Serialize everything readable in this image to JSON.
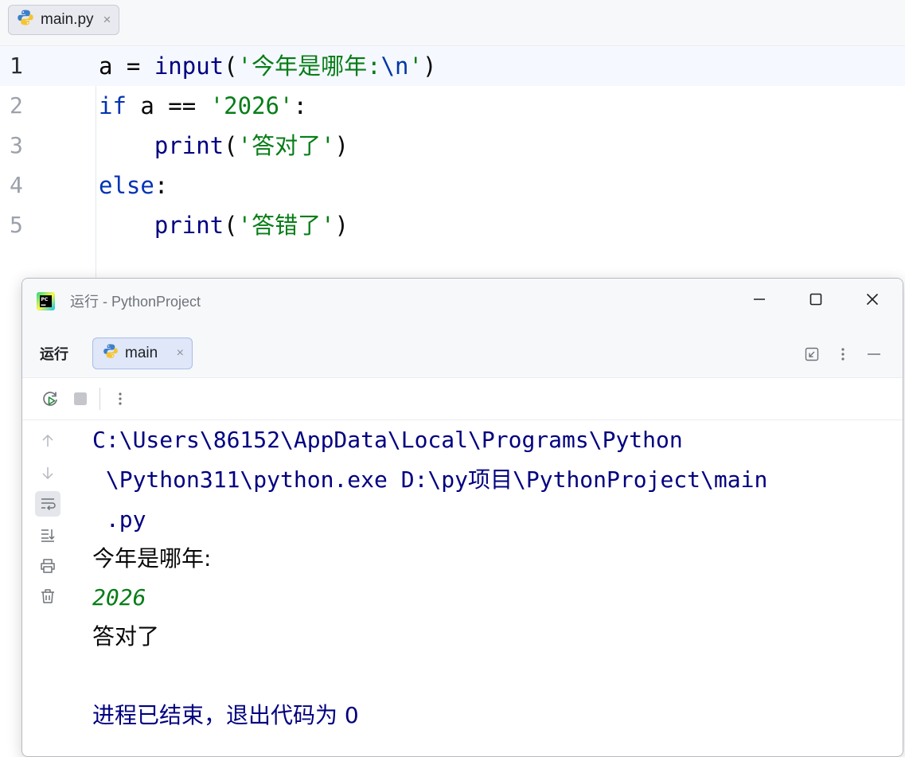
{
  "editor": {
    "tab": {
      "filename": "main.py",
      "close": "×"
    },
    "lines": [
      {
        "number": "1",
        "tokens": {
          "a": "a = ",
          "b": "input",
          "c": "(",
          "d": "'今年是哪年:",
          "e": "\\n",
          "f": "'",
          "g": ")"
        }
      },
      {
        "number": "2",
        "tokens": {
          "a": "if",
          "b": " a == ",
          "c": "'2026'",
          "d": ":"
        }
      },
      {
        "number": "3",
        "tokens": {
          "a": "    ",
          "b": "print",
          "c": "(",
          "d": "'答对了'",
          "e": ")"
        }
      },
      {
        "number": "4",
        "tokens": {
          "a": "else",
          "b": ":"
        }
      },
      {
        "number": "5",
        "tokens": {
          "a": "    ",
          "b": "print",
          "c": "(",
          "d": "'答错了'",
          "e": ")"
        }
      }
    ]
  },
  "run_window": {
    "title": "运行 - PythonProject",
    "tool_label": "运行",
    "run_tab": {
      "label": "main",
      "close": "×"
    },
    "console": {
      "cmd_line_1": "C:\\Users\\86152\\AppData\\Local\\Programs\\Python",
      "cmd_line_2": " \\Python311\\python.exe D:\\py项目\\PythonProject\\main",
      "cmd_line_3": " .py",
      "prompt": "今年是哪年:",
      "user_input": "2026",
      "output": "答对了",
      "exit_msg": "进程已结束，退出代码为 0"
    }
  },
  "icons": {
    "python_file": "python-icon",
    "pycharm_app": "pycharm-icon",
    "minimize": "minimize-icon",
    "maximize": "maximize-icon",
    "close": "close-icon",
    "rerun": "rerun-icon",
    "stop": "stop-icon"
  },
  "colors": {
    "keyword": "#0033b3",
    "builtin": "#000080",
    "string": "#067d17",
    "current_line": "#f5f8fe"
  }
}
